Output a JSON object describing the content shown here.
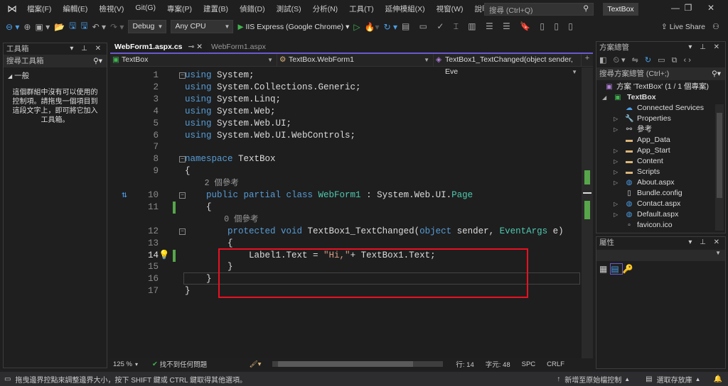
{
  "menu": [
    "檔案(F)",
    "編輯(E)",
    "檢視(V)",
    "Git(G)",
    "專案(P)",
    "建置(B)",
    "偵錯(D)",
    "測試(S)",
    "分析(N)",
    "工具(T)",
    "延伸模組(X)",
    "視窗(W)",
    "說明(H)"
  ],
  "search": {
    "placeholder": "搜尋 (Ctrl+Q)"
  },
  "project_badge": "TextBox",
  "toolbar": {
    "config": "Debug",
    "platform": "Any CPU",
    "run_label": "IIS Express (Google Chrome)",
    "live_share": "Live Share"
  },
  "toolbox": {
    "title": "工具箱",
    "search": "搜尋工具箱",
    "group": "一般",
    "empty_msg": "這個群組中沒有可以使用的控制項。請拖曳一個項目到這段文字上，即可將它加入工具箱。"
  },
  "editor": {
    "tabs": [
      {
        "label": "WebForm1.aspx.cs",
        "active": true
      },
      {
        "label": "WebForm1.aspx",
        "active": false
      }
    ],
    "nav": {
      "project": "TextBox",
      "class": "TextBox.WebForm1",
      "member": "TextBox1_TextChanged(object sender, Eve"
    },
    "lines": [
      {
        "n": "1",
        "tokens": [
          [
            "kw",
            "using"
          ],
          [
            "pl",
            " System;"
          ]
        ]
      },
      {
        "n": "2",
        "tokens": [
          [
            "kw",
            "using"
          ],
          [
            "pl",
            " System.Collections.Generic;"
          ]
        ]
      },
      {
        "n": "3",
        "tokens": [
          [
            "kw",
            "using"
          ],
          [
            "pl",
            " System.Linq;"
          ]
        ]
      },
      {
        "n": "4",
        "tokens": [
          [
            "kw",
            "using"
          ],
          [
            "pl",
            " System.Web;"
          ]
        ]
      },
      {
        "n": "5",
        "tokens": [
          [
            "kw",
            "using"
          ],
          [
            "pl",
            " System.Web.UI;"
          ]
        ]
      },
      {
        "n": "6",
        "tokens": [
          [
            "kw",
            "using"
          ],
          [
            "pl",
            " System.Web.UI.WebControls;"
          ]
        ]
      },
      {
        "n": "7",
        "tokens": []
      },
      {
        "n": "8",
        "tokens": [
          [
            "kw",
            "namespace"
          ],
          [
            "pl",
            " TextBox"
          ]
        ]
      },
      {
        "n": "9",
        "tokens": [
          [
            "pl",
            "{"
          ]
        ]
      },
      {
        "n": "",
        "lens": "    2 個參考"
      },
      {
        "n": "10",
        "tokens": [
          [
            "pl",
            "    "
          ],
          [
            "kw",
            "public partial class "
          ],
          [
            "ty",
            "WebForm1"
          ],
          [
            "pl",
            " : System.Web.UI."
          ],
          [
            "ty",
            "Page"
          ]
        ]
      },
      {
        "n": "11",
        "tokens": [
          [
            "pl",
            "    {"
          ]
        ]
      },
      {
        "n": "",
        "lens": "        0 個參考"
      },
      {
        "n": "12",
        "tokens": [
          [
            "pl",
            "        "
          ],
          [
            "kw",
            "protected void "
          ],
          [
            "pl",
            "TextBox1_TextChanged("
          ],
          [
            "kw",
            "object"
          ],
          [
            "pl",
            " sender, "
          ],
          [
            "ty",
            "EventArgs"
          ],
          [
            "pl",
            " e)"
          ]
        ]
      },
      {
        "n": "13",
        "tokens": [
          [
            "pl",
            "        {"
          ]
        ]
      },
      {
        "n": "14",
        "tokens": [
          [
            "pl",
            "            Label1.Text = "
          ],
          [
            "st",
            "\"Hi,\""
          ],
          [
            "pl",
            "+ TextBox1.Text;"
          ]
        ]
      },
      {
        "n": "15",
        "tokens": [
          [
            "pl",
            "        }"
          ]
        ]
      },
      {
        "n": "16",
        "tokens": [
          [
            "pl",
            "    }"
          ]
        ]
      },
      {
        "n": "17",
        "tokens": [
          [
            "pl",
            "}"
          ]
        ]
      }
    ],
    "status": {
      "zoom": "125 %",
      "issues": "找不到任何問題",
      "line": "行: 14",
      "col": "字元: 48",
      "spc": "SPC",
      "eol": "CRLF"
    }
  },
  "solution_explorer": {
    "title": "方案總管",
    "search": "搜尋方案總管 (Ctrl+;)",
    "solution": "方案 'TextBox' (1 / 1 個專案)",
    "project": "TextBox",
    "items": [
      {
        "label": "Connected Services",
        "icon": "cloud-icon",
        "expandable": false
      },
      {
        "label": "Properties",
        "icon": "wrench-icon",
        "expandable": true
      },
      {
        "label": "參考",
        "icon": "references-icon",
        "expandable": true
      },
      {
        "label": "App_Data",
        "icon": "folder-icon",
        "expandable": false
      },
      {
        "label": "App_Start",
        "icon": "folder-icon",
        "expandable": true
      },
      {
        "label": "Content",
        "icon": "folder-icon",
        "expandable": true
      },
      {
        "label": "Scripts",
        "icon": "folder-icon",
        "expandable": true
      },
      {
        "label": "About.aspx",
        "icon": "web-file-icon",
        "expandable": true
      },
      {
        "label": "Bundle.config",
        "icon": "config-file-icon",
        "expandable": false
      },
      {
        "label": "Contact.aspx",
        "icon": "web-file-icon",
        "expandable": true
      },
      {
        "label": "Default.aspx",
        "icon": "web-file-icon",
        "expandable": true
      },
      {
        "label": "favicon.ico",
        "icon": "image-file-icon",
        "expandable": false
      }
    ]
  },
  "properties": {
    "title": "屬性"
  },
  "statusbar": {
    "message": "拖曳邊界控點來調整邊界大小，按下 SHIFT 鍵或 CTRL 鍵取得其他選項。",
    "source_control": "新增至原始檔控制",
    "repo": "選取存放庫"
  }
}
